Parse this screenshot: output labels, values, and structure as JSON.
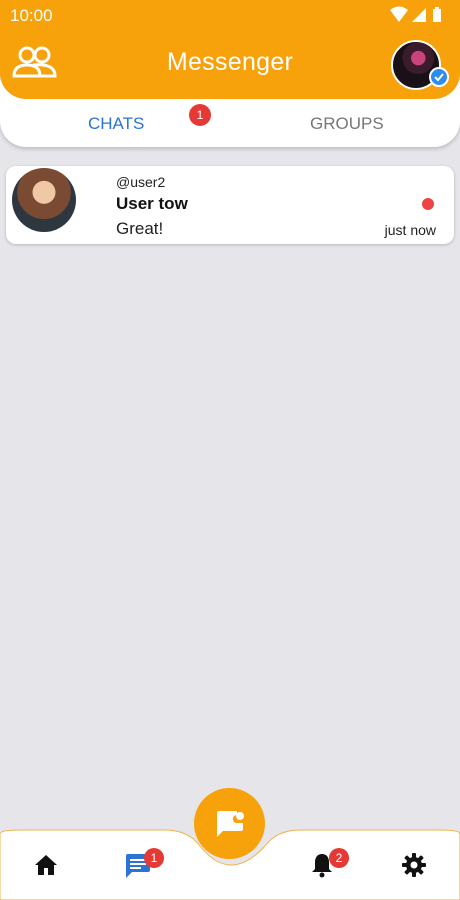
{
  "status_bar": {
    "time": "10:00"
  },
  "header": {
    "title": "Messenger"
  },
  "tabs": [
    {
      "label": "CHATS",
      "badge": "1"
    },
    {
      "label": "GROUPS"
    }
  ],
  "chats": [
    {
      "handle": "@user2",
      "name": "User tow",
      "last_message": "Great!",
      "time": "just now"
    }
  ],
  "bottom_nav": {
    "items": [
      {
        "icon": "home-icon"
      },
      {
        "icon": "chat-icon",
        "badge": "1"
      },
      {
        "icon": "bell-icon",
        "badge": "2"
      },
      {
        "icon": "gear-icon"
      }
    ],
    "fab_icon": "new-message-icon"
  },
  "colors": {
    "accent": "#f7a10b",
    "active_tab": "#2b73d6",
    "badge": "#e53935",
    "background": "#e5e5ea"
  }
}
